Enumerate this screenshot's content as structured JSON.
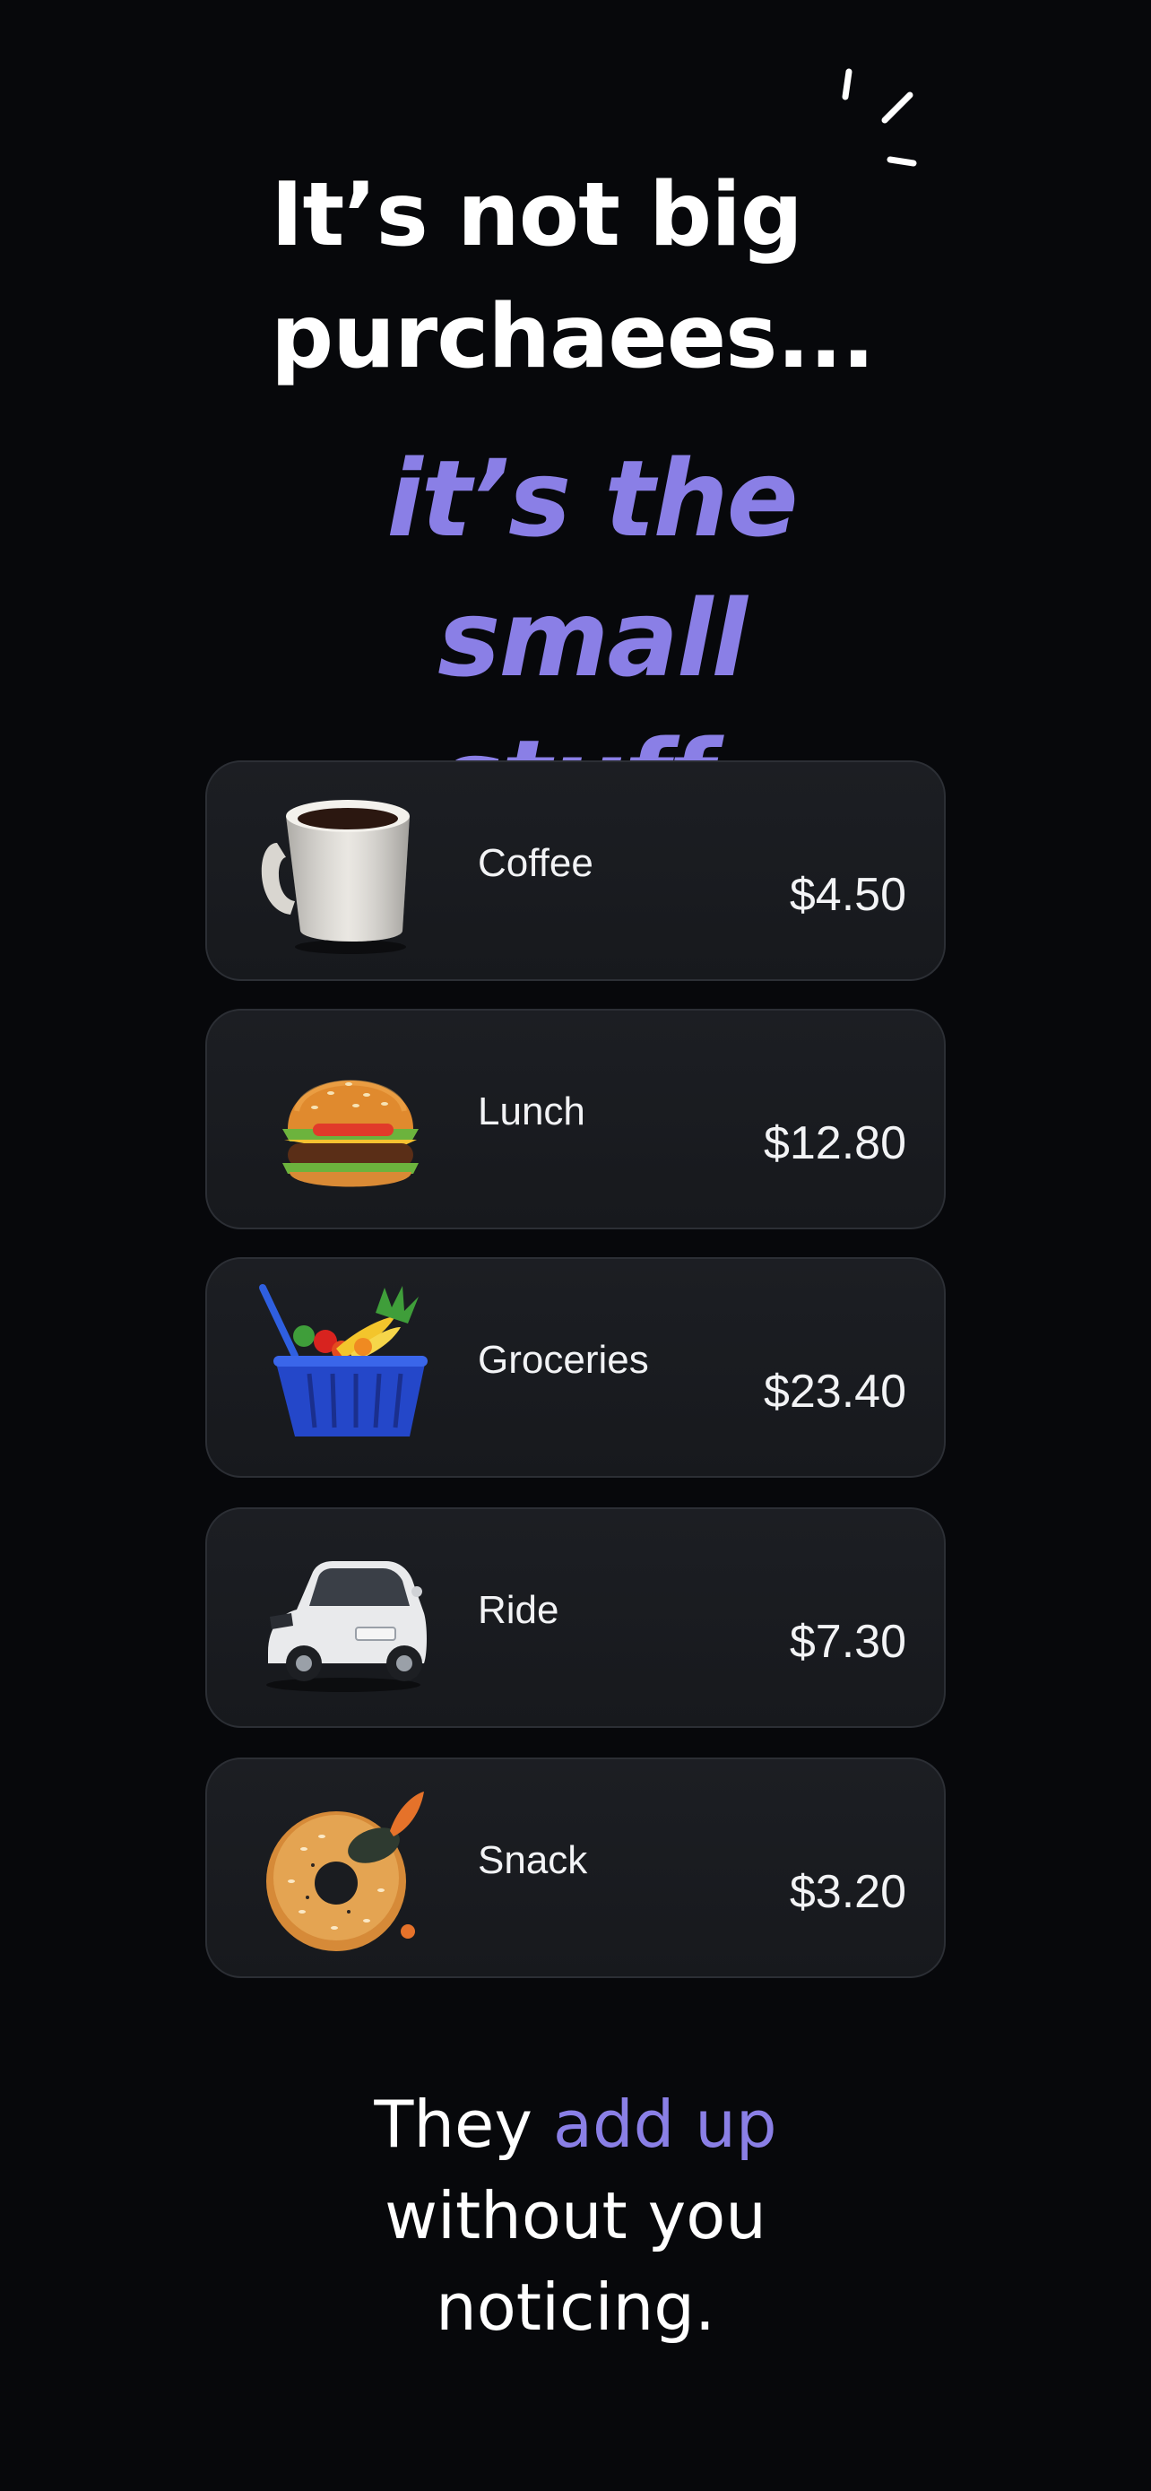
{
  "headline": {
    "line1": "It’s not big",
    "line2": "purchaees..."
  },
  "subhead": {
    "line1": "it’s the small",
    "line2": "stuff."
  },
  "expenses": [
    {
      "label": "Coffee",
      "price": "$4.50",
      "icon": "coffee-mug-icon"
    },
    {
      "label": "Lunch",
      "price": "$12.80",
      "icon": "burger-icon"
    },
    {
      "label": "Groceries",
      "price": "$23.40",
      "icon": "grocery-basket-icon"
    },
    {
      "label": "Ride",
      "price": "$7.30",
      "icon": "car-icon"
    },
    {
      "label": "Snack",
      "price": "$3.20",
      "icon": "bagel-icon"
    }
  ],
  "footer": {
    "before": "They ",
    "highlight": "add up",
    "line2": "without you",
    "line3": "noticing."
  },
  "colors": {
    "background": "#07080b",
    "accent": "#8a7fe6",
    "card": "#1a1c20"
  }
}
